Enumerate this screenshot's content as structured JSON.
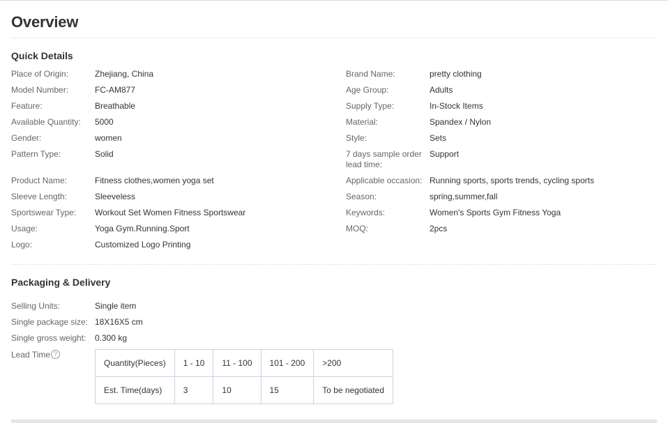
{
  "page": {
    "title": "Overview"
  },
  "quick_details": {
    "title": "Quick Details",
    "left": [
      {
        "label": "Place of Origin:",
        "value": "Zhejiang, China"
      },
      {
        "label": "Model Number:",
        "value": "FC-AM877"
      },
      {
        "label": "Feature:",
        "value": "Breathable"
      },
      {
        "label": "Available Quantity:",
        "value": "5000"
      },
      {
        "label": "Gender:",
        "value": "women"
      },
      {
        "label": "Pattern Type:",
        "value": "Solid"
      },
      {
        "label": "Product Name:",
        "value": "Fitness clothes,women yoga set"
      },
      {
        "label": "Sleeve Length:",
        "value": "Sleeveless"
      },
      {
        "label": "Sportswear Type:",
        "value": "Workout Set Women Fitness Sportswear"
      },
      {
        "label": "Usage:",
        "value": "Yoga Gym.Running.Sport"
      },
      {
        "label": "Logo:",
        "value": "Customized Logo Printing"
      }
    ],
    "right": [
      {
        "label": "Brand Name:",
        "value": "pretty clothing"
      },
      {
        "label": "Age Group:",
        "value": "Adults"
      },
      {
        "label": "Supply Type:",
        "value": "In-Stock Items"
      },
      {
        "label": "Material:",
        "value": "Spandex / Nylon"
      },
      {
        "label": "Style:",
        "value": "Sets"
      },
      {
        "label": "7 days sample order lead time:",
        "value": "Support"
      },
      {
        "label": "Applicable occasion:",
        "value": "Running sports, sports trends, cycling sports"
      },
      {
        "label": "Season:",
        "value": "spring,summer,fall"
      },
      {
        "label": "Keywords:",
        "value": "Women's Sports Gym Fitness Yoga"
      },
      {
        "label": "MOQ:",
        "value": "2pcs"
      }
    ]
  },
  "packaging": {
    "title": "Packaging & Delivery",
    "items": [
      {
        "label": "Selling Units:",
        "value": "Single item"
      },
      {
        "label": "Single package size:",
        "value": "18X16X5 cm"
      },
      {
        "label": "Single gross weight:",
        "value": "0.300 kg"
      }
    ],
    "lead_time_label": "Lead Time",
    "help_icon": "question-circle-icon",
    "help_glyph": "?",
    "lead_table": {
      "header": [
        "Quantity(Pieces)",
        "1 - 10",
        "11 - 100",
        "101 - 200",
        ">200"
      ],
      "row": [
        "Est. Time(days)",
        "3",
        "10",
        "15",
        "To be negotiated"
      ]
    }
  }
}
